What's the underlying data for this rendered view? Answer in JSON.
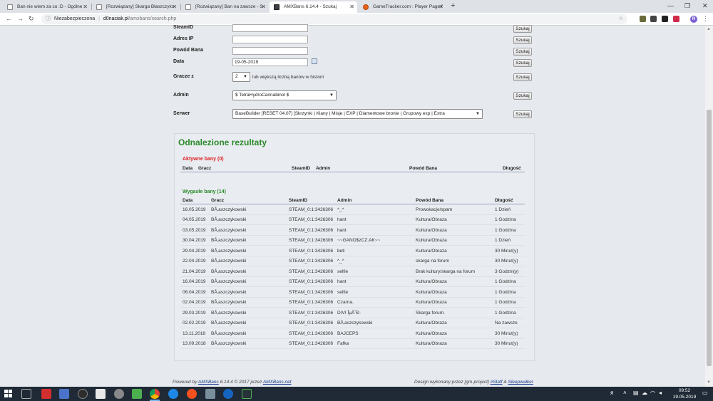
{
  "browser": {
    "tabs": [
      {
        "title": "Ban nie wiem za co :D - Ogólne",
        "icon": "page-icon"
      },
      {
        "title": "[Rozwiązany] Skarga Błaszczyko",
        "icon": "page-icon"
      },
      {
        "title": "[Rozwiązany] Ban na zawsze - S",
        "icon": "page-icon"
      },
      {
        "title": "AMXBans 6.14.4 - Szukaj",
        "icon": "amx-icon",
        "active": true
      },
      {
        "title": "GameTracker.com : Player Page f",
        "icon": "gametracker-icon"
      }
    ],
    "new_tab": "+",
    "address": {
      "security": "Niezabezpieczona",
      "host": "d0naciak.pl",
      "path": "/amxbans/search.php"
    },
    "profile_initial": "R"
  },
  "search_form": {
    "steamid_label": "SteamID",
    "ip_label": "Adres IP",
    "reason_label": "Powód Bana",
    "date_label": "Data",
    "date_value": "19-05-2019",
    "players_label": "Gracze z",
    "players_value": "2",
    "players_note": "lub większą liczbą banów w historii",
    "admin_label": "Admin",
    "admin_value": "$ TetraHydroCannabinol $",
    "server_label": "Serwer",
    "server_value": "BaseBuilder [RESET 04.07] [Skrzynki | Klany | Misje | EXP | Diamentowe bronie | Grupowy exp | Extra",
    "search_button": "Szukaj"
  },
  "results": {
    "title": "Odnalezione rezultaty",
    "active_title": "Aktywne bany (0)",
    "active_columns": {
      "date": "Data",
      "player": "Gracz",
      "steam": "SteamID",
      "admin": "Admin",
      "reason": "Powód Bana",
      "length": "Długość"
    },
    "expired_title": "Wygasłe bany (14)",
    "expired_columns": {
      "date": "Data",
      "player": "Gracz",
      "steam": "SteamID",
      "admin": "Admin",
      "reason": "Powód Bana",
      "length": "Długość"
    },
    "rows": [
      {
        "date": "16.05.2019",
        "player": "BÅ‚aszczykowski",
        "steam": "STEAM_0:1:3426306",
        "admin": "^_^",
        "reason": "Prowokacje/spam",
        "length": "1 Dzień"
      },
      {
        "date": "04.05.2019",
        "player": "BÅ‚aszczykowski",
        "steam": "STEAM_0:1:3426306",
        "admin": "hant",
        "reason": "Kultura/Obraza",
        "length": "1 Godzina"
      },
      {
        "date": "03.05.2019",
        "player": "BÅ‚aszczykowski",
        "steam": "STEAM_0:1:3426306",
        "admin": "hant",
        "reason": "Kultura/Obraza",
        "length": "1 Godzina"
      },
      {
        "date": "30.04.2019",
        "player": "BÅ‚aszczykowski",
        "steam": "STEAM_0:1:3426306",
        "admin": "~~GANO$zCZ.AK~~",
        "reason": "Kultura/Obraza",
        "length": "1 Dzień"
      },
      {
        "date": "29.04.2019",
        "player": "BÅ‚aszczykowski",
        "steam": "STEAM_0:1:3426306",
        "admin": "beti",
        "reason": "Kultura/Obraza",
        "length": "30 Minut(y)"
      },
      {
        "date": "22.04.2019",
        "player": "BÅ‚aszczykowski",
        "steam": "STEAM_0:1:3426306",
        "admin": "^_^",
        "reason": "skarga na forum",
        "length": "30 Minut(y)"
      },
      {
        "date": "21.04.2019",
        "player": "BÅ‚aszczykowski",
        "steam": "STEAM_0:1:3426306",
        "admin": "selfie",
        "reason": "Brak kultury/skarga na forum",
        "length": "3 Godzin(y)"
      },
      {
        "date": "16.04.2019",
        "player": "BÅ‚aszczykowski",
        "steam": "STEAM_0:1:3426306",
        "admin": "hant",
        "reason": "Kultura/Obraza",
        "length": "1 Godzina"
      },
      {
        "date": "06.04.2019",
        "player": "BÅ‚aszczykowski",
        "steam": "STEAM_0:1:3426306",
        "admin": "selfie",
        "reason": "Kultura/Obraza",
        "length": "1 Godzina"
      },
      {
        "date": "02.04.2019",
        "player": "BÅ‚aszczykowski",
        "steam": "STEAM_0:1:3426306",
        "admin": "Czarna.",
        "reason": "Kultura/Obraza",
        "length": "1 Godzina"
      },
      {
        "date": "29.03.2019",
        "player": "BÅ‚aszczykowski",
        "steam": "STEAM_0:1:3426306",
        "admin": "DIVI ÎµÃ˜Ð·",
        "reason": "Skarga forum.",
        "length": "1 Godzina"
      },
      {
        "date": "02.02.2019",
        "player": "BÅ‚aszczykowski",
        "steam": "STEAM_0:1:3426306",
        "admin": "BÅ‚aszczykowski",
        "reason": "Kultura/Obraza",
        "length": "Na zawsze"
      },
      {
        "date": "13.11.2018",
        "player": "BÅ‚aszczykowski",
        "steam": "STEAM_0:1:3426306",
        "admin": "BAJCEPS",
        "reason": "Kultura/Obraza",
        "length": "30 Minut(y)"
      },
      {
        "date": "13.09.2018",
        "player": "BÅ‚aszczykowski",
        "steam": "STEAM_0:1:3426306",
        "admin": "Fafka",
        "reason": "Kultura/Obraza",
        "length": "30 Minut(y)"
      }
    ]
  },
  "footer": {
    "left_prefix": "Powered by ",
    "left_link": "AMXBans",
    "left_mid": " 6.14.4 © 2017 przez ",
    "left_link2": "AMXBans.net",
    "right_prefix": "Design wykonany przez [gm-project] ",
    "right_link": "#Staff",
    "right_mid": " & ",
    "right_link2": "Sleepwalker"
  },
  "taskbar": {
    "time": "09:52",
    "date": "19.05.2019"
  },
  "colors": {
    "results_title": "#2b8a2b",
    "active_bans": "#dd2222",
    "expired_bans": "#2b8a2b",
    "page_bg": "#e6e9ee"
  }
}
